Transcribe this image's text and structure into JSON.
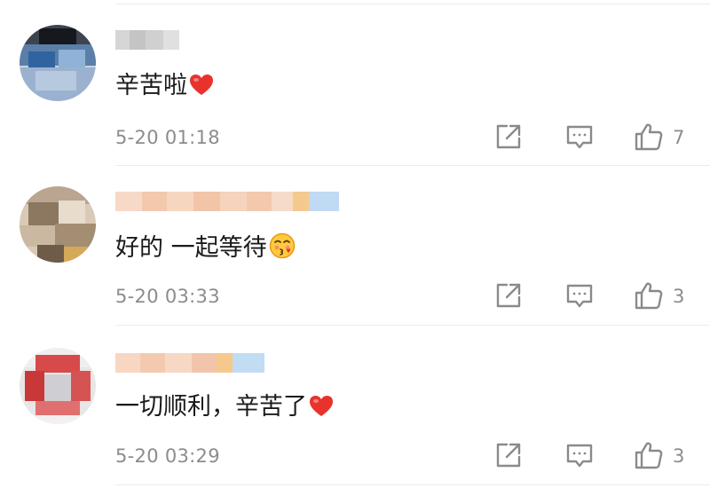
{
  "comments": [
    {
      "text": "辛苦啦",
      "emoji": "red-heart",
      "timestamp": "5-20 01:18",
      "likes": "7"
    },
    {
      "text": "好的 一起等待",
      "emoji": "kissing-face",
      "timestamp": "5-20 03:33",
      "likes": "3"
    },
    {
      "text": "一切顺利，辛苦了",
      "emoji": "red-heart",
      "timestamp": "5-20 03:29",
      "likes": "3"
    }
  ],
  "icons": {
    "share": "share-icon",
    "reply": "comment-icon",
    "like": "thumbs-up-icon"
  },
  "colors": {
    "text": "#1a1a1a",
    "meta": "#8c8c8c",
    "icon": "#8a8a8a",
    "heart": "#e8332d",
    "divider": "#ececec"
  }
}
